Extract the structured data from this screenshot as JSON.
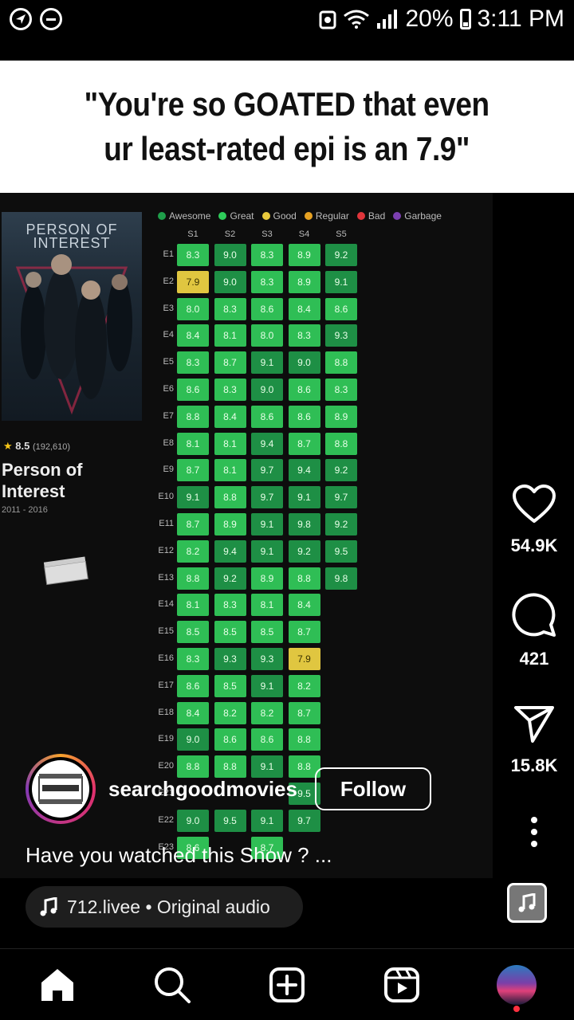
{
  "status_bar": {
    "battery": "20%",
    "time": "3:11 PM"
  },
  "banner": {
    "line1": "\"You're so GOATED that even",
    "line2": "ur least-rated epi is an 7.9\""
  },
  "show": {
    "poster_title": "PERSON OF INTEREST",
    "rating": "8.5",
    "rating_count": "(192,610)",
    "title": "Person of Interest",
    "years": "2011 - 2016"
  },
  "legend": [
    {
      "label": "Awesome",
      "color": "#1f9e4a"
    },
    {
      "label": "Great",
      "color": "#2ecc5a"
    },
    {
      "label": "Good",
      "color": "#e8c93c"
    },
    {
      "label": "Regular",
      "color": "#e6a122"
    },
    {
      "label": "Bad",
      "color": "#e0353b"
    },
    {
      "label": "Garbage",
      "color": "#7b3fb0"
    }
  ],
  "chart_data": {
    "type": "heatmap",
    "columns": [
      "S1",
      "S2",
      "S3",
      "S4",
      "S5"
    ],
    "rows": [
      "E1",
      "E2",
      "E3",
      "E4",
      "E5",
      "E6",
      "E7",
      "E8",
      "E9",
      "E10",
      "E11",
      "E12",
      "E13",
      "E14",
      "E15",
      "E16",
      "E17",
      "E18",
      "E19",
      "E20",
      "E21",
      "E22",
      "E23"
    ],
    "values": [
      [
        8.3,
        9.0,
        8.3,
        8.9,
        9.2
      ],
      [
        7.9,
        9.0,
        8.3,
        8.9,
        9.1
      ],
      [
        8.0,
        8.3,
        8.6,
        8.4,
        8.6
      ],
      [
        8.4,
        8.1,
        8.0,
        8.3,
        9.3
      ],
      [
        8.3,
        8.7,
        9.1,
        9.0,
        8.8
      ],
      [
        8.6,
        8.3,
        9.0,
        8.6,
        8.3
      ],
      [
        8.8,
        8.4,
        8.6,
        8.6,
        8.9
      ],
      [
        8.1,
        8.1,
        9.4,
        8.7,
        8.8
      ],
      [
        8.7,
        8.1,
        9.7,
        9.4,
        9.2
      ],
      [
        9.1,
        8.8,
        9.7,
        9.1,
        9.7
      ],
      [
        8.7,
        8.9,
        9.1,
        9.8,
        9.2
      ],
      [
        8.2,
        9.4,
        9.1,
        9.2,
        9.5
      ],
      [
        8.8,
        9.2,
        8.9,
        8.8,
        9.8
      ],
      [
        8.1,
        8.3,
        8.1,
        8.4,
        null
      ],
      [
        8.5,
        8.5,
        8.5,
        8.7,
        null
      ],
      [
        8.3,
        9.3,
        9.3,
        7.9,
        null
      ],
      [
        8.6,
        8.5,
        9.1,
        8.2,
        null
      ],
      [
        8.4,
        8.2,
        8.2,
        8.7,
        null
      ],
      [
        9.0,
        8.6,
        8.6,
        8.8,
        null
      ],
      [
        8.8,
        8.8,
        9.1,
        8.8,
        null
      ],
      [
        null,
        null,
        null,
        9.5,
        null
      ],
      [
        9.0,
        9.5,
        9.1,
        9.7,
        null
      ],
      [
        8.6,
        null,
        8.7,
        null,
        null
      ]
    ],
    "category_colors": {
      "awesome": "#1e8f45",
      "great": "#2fbe55",
      "good": "#e0c640"
    },
    "legend_position": "top"
  },
  "actions": {
    "likes": "54.9K",
    "comments": "421",
    "shares": "15.8K"
  },
  "author": {
    "username": "searchgoodmovies",
    "follow_label": "Follow",
    "watermark": "SEARCHGOODMOVIES"
  },
  "caption": "Have you watched this Show ? ...",
  "audio": {
    "label": "712.livee • Original audio"
  },
  "icons": {
    "like": "heart-icon",
    "comment": "comment-icon",
    "share": "send-icon",
    "more": "more-icon",
    "home": "home-icon",
    "search": "search-icon",
    "create": "plus-square-icon",
    "reels": "reels-icon"
  }
}
